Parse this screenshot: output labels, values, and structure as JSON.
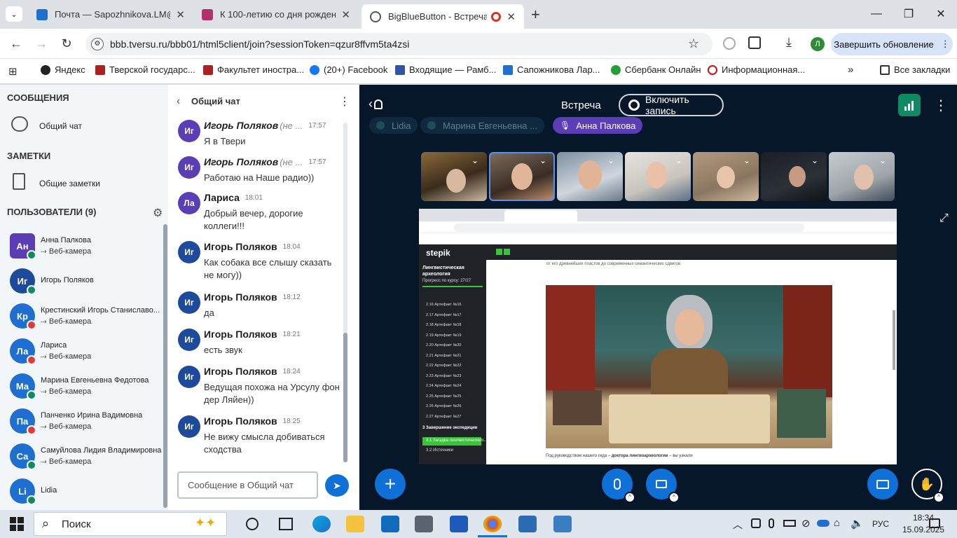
{
  "browser": {
    "tabs": [
      {
        "title": "Почта — Sapozhnikova.LM@tversu.ru",
        "color": "#1f6fd1"
      },
      {
        "title": "К 100-летию со дня рождения",
        "color": "#b0306a"
      },
      {
        "title": "BigBlueButton - Встреча - Г",
        "color": "#555"
      }
    ],
    "url": "bbb.tversu.ru/bbb01/html5client/join?sessionToken=qzur8ffvm5ta4zsi",
    "update_label": "Завершить обновление",
    "profile_letter": "Л",
    "bookmarks": [
      {
        "label": "Яндекс",
        "color": "#222"
      },
      {
        "label": "Тверской государс...",
        "color": "#a22"
      },
      {
        "label": "Факультет иностра...",
        "color": "#a22"
      },
      {
        "label": "(20+) Facebook",
        "color": "#1877f2"
      },
      {
        "label": "Входящие — Рамб...",
        "color": "#3253a8"
      },
      {
        "label": "Сапожникова Лар...",
        "color": "#1f6fd1"
      },
      {
        "label": "Сбербанк Онлайн",
        "color": "#21a038"
      },
      {
        "label": "Информационная...",
        "color": "#c11"
      }
    ],
    "all_bookmarks": "Все закладки"
  },
  "sidebar": {
    "messages_title": "СООБЩЕНИЯ",
    "public_chat": "Общий чат",
    "notes_title": "ЗАМЕТКИ",
    "shared_notes": "Общие заметки",
    "users_title": "ПОЛЬЗОВАТЕЛИ (9)",
    "users": [
      {
        "initials": "Ан",
        "name": "Анна Палкова",
        "status": "Веб-камера",
        "color": "#5b3db5",
        "mic": "on",
        "shape": "square"
      },
      {
        "initials": "Иг",
        "name": "Игорь Поляков",
        "status": "",
        "color": "#1e4a9c",
        "mic": "on",
        "shape": "round"
      },
      {
        "initials": "Кр",
        "name": "Крестинский Игорь Станиславо...",
        "status": "Веб-камера",
        "color": "#1f6fd1",
        "mic": "off",
        "shape": "round"
      },
      {
        "initials": "Ла",
        "name": "Лариса",
        "status": "Веб-камера",
        "color": "#1f6fd1",
        "mic": "off",
        "shape": "round"
      },
      {
        "initials": "Ма",
        "name": "Марина Евгеньевна Федотова",
        "status": "Веб-камера",
        "color": "#1f6fd1",
        "mic": "on",
        "shape": "round"
      },
      {
        "initials": "Па",
        "name": "Панченко Ирина Вадимовна",
        "status": "Веб-камера",
        "color": "#1f6fd1",
        "mic": "off",
        "shape": "round"
      },
      {
        "initials": "Са",
        "name": "Самуйлова Лидия Владимировна",
        "status": "Веб-камера",
        "color": "#1f6fd1",
        "mic": "on",
        "shape": "round"
      },
      {
        "initials": "Li",
        "name": "Lidia",
        "status": "",
        "color": "#1f6fd1",
        "mic": "on",
        "shape": "round"
      }
    ]
  },
  "chat": {
    "title": "Общий чат",
    "messages": [
      {
        "initials": "Иг",
        "name": "Игорь Поляков",
        "tag": "(не ...",
        "time": "17:57",
        "text": "Я в Твери",
        "color": "#5b3db5"
      },
      {
        "initials": "Иг",
        "name": "Игорь Поляков",
        "tag": "(не ...",
        "time": "17:57",
        "text": "Работаю на Наше радио))",
        "color": "#5b3db5"
      },
      {
        "initials": "Ла",
        "name": "Лариса",
        "tag": "",
        "time": "18:01",
        "text": "Добрый вечер, дорогие коллеги!!!",
        "color": "#5b3db5"
      },
      {
        "initials": "Иг",
        "name": "Игорь Поляков",
        "tag": "",
        "time": "18:04",
        "text": "Как собака все слышу сказать не могу))",
        "color": "#1e4a9c"
      },
      {
        "initials": "Иг",
        "name": "Игорь Поляков",
        "tag": "",
        "time": "18:12",
        "text": "да",
        "color": "#1e4a9c"
      },
      {
        "initials": "Иг",
        "name": "Игорь Поляков",
        "tag": "",
        "time": "18:21",
        "text": "есть звук",
        "color": "#1e4a9c"
      },
      {
        "initials": "Иг",
        "name": "Игорь Поляков",
        "tag": "",
        "time": "18:24",
        "text": "Ведущая похожа на Урсулу фон дер Ляйен))",
        "color": "#1e4a9c"
      },
      {
        "initials": "Иг",
        "name": "Игорь Поляков",
        "tag": "",
        "time": "18:25",
        "text": "Не вижу смысла добиваться сходства",
        "color": "#1e4a9c"
      }
    ],
    "input_placeholder": "Сообщение в Общий чат"
  },
  "meeting": {
    "title": "Встреча",
    "record_label": "Включить запись",
    "talkers": [
      {
        "name": "Lidia",
        "active": false
      },
      {
        "name": "Марина Евгеньевна ...",
        "active": false
      },
      {
        "name": "Анна Палкова",
        "active": true
      }
    ]
  },
  "screenshare": {
    "site": "stepik",
    "course_title": "Лингвистическая археология",
    "progress": "Прогресс по курсу: 27/27",
    "lessons": [
      "2.16 Артефакт №16",
      "2.17 Артефакт №17",
      "2.18 Артефакт №18",
      "2.19 Артефакт №19",
      "2.20 Артефакт №20",
      "2.21 Артефакт №21",
      "2.22 Артефакт №22",
      "2.23 Артефакт №23",
      "2.24 Артефакт №24",
      "2.25 Артефакт №25",
      "2.26 Артефакт №26",
      "2.27 Артефакт №27"
    ],
    "section": "3  Завершение экспедиции",
    "active_lesson": "3.1 Загадка лингвистического...",
    "next_lesson": "3.2 Источники",
    "top_text": "от его древнейших пластов до современных семантических сдвигов.",
    "caption_before": "Под руководством нашего гида – ",
    "caption_bold": "доктора лингвоархеологии",
    "caption_after": " – вы узнали"
  },
  "taskbar": {
    "search": "Поиск",
    "lang": "РУС",
    "time": "18:34",
    "date": "15.09.2025"
  }
}
